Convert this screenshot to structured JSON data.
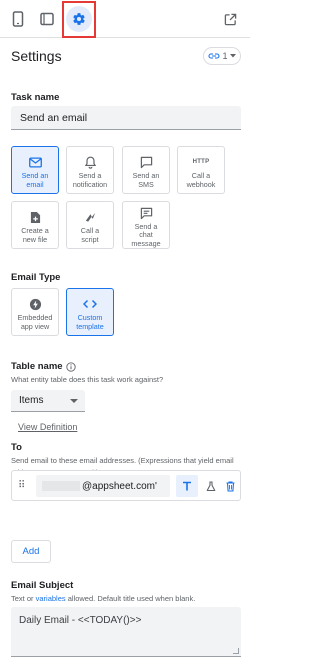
{
  "toolbar": {
    "icons": [
      "phone-icon",
      "tablet-icon",
      "gear-icon",
      "open-external-icon"
    ],
    "accent": "#1a73e8",
    "highlight_color": "#e53935"
  },
  "header": {
    "title": "Settings",
    "link_chip_value": "1"
  },
  "task_name": {
    "label": "Task name",
    "value": "Send an email"
  },
  "task_types": [
    {
      "line1": "Send an",
      "line2": "email",
      "icon": "mail-icon",
      "selected": true
    },
    {
      "line1": "Send a",
      "line2": "notification",
      "icon": "bell-icon",
      "selected": false
    },
    {
      "line1": "Send an",
      "line2": "SMS",
      "icon": "chat-bubble-icon",
      "selected": false
    },
    {
      "line1": "Call a",
      "line2": "webhook",
      "icon": "http-icon",
      "icon_text": "HTTP",
      "selected": false
    },
    {
      "line1": "Create a",
      "line2": "new file",
      "icon": "new-file-icon",
      "selected": false
    },
    {
      "line1": "Call a",
      "line2": "script",
      "icon": "script-icon",
      "selected": false
    },
    {
      "line1": "Send a",
      "line2": "chat",
      "line3": "message",
      "icon": "chat-message-icon",
      "selected": false
    }
  ],
  "email_type": {
    "label": "Email Type",
    "options": [
      {
        "line1": "Embedded",
        "line2": "app view",
        "icon": "bolt-icon",
        "selected": false
      },
      {
        "line1": "Custom",
        "line2": "template",
        "icon": "code-icon",
        "selected": true
      }
    ]
  },
  "table_name": {
    "label": "Table name",
    "help": "What entity table does this task work against?",
    "selected": "Items",
    "view_definition": "View Definition"
  },
  "to": {
    "label": "To",
    "help": "Send email to these email addresses. (Expressions that yield email addresses are supported.)",
    "email_value": "@appsheet.com'",
    "add_label": "Add"
  },
  "subject": {
    "label": "Email Subject",
    "help_prefix": "Text or",
    "help_link": "variables",
    "help_suffix": "allowed. Default title used when blank.",
    "value": "Daily Email - <<TODAY()>>"
  }
}
